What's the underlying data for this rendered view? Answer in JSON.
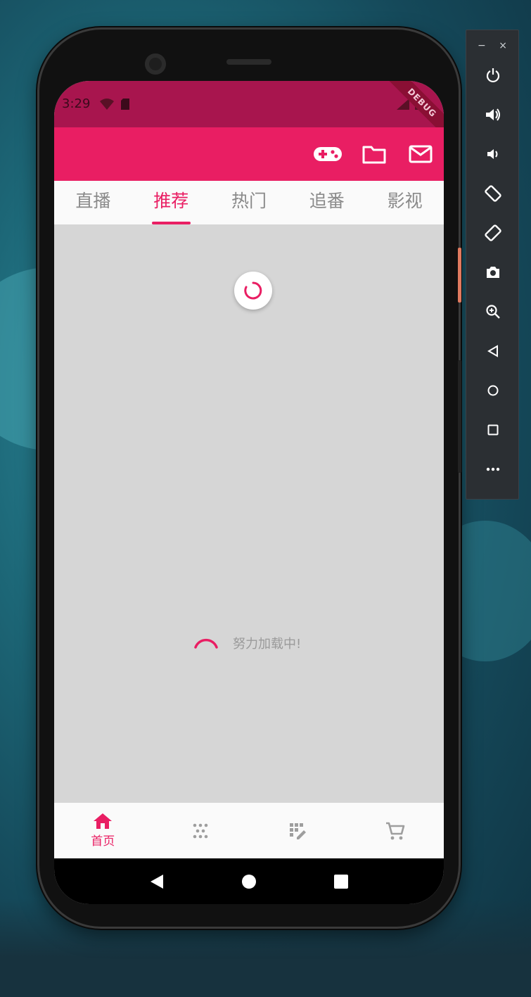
{
  "status_bar": {
    "time": "3:29",
    "debug_label": "DEBUG"
  },
  "tabs": [
    {
      "label": "直播",
      "active": false
    },
    {
      "label": "推荐",
      "active": true
    },
    {
      "label": "热门",
      "active": false
    },
    {
      "label": "追番",
      "active": false
    },
    {
      "label": "影视",
      "active": false
    }
  ],
  "loading": {
    "text": "努力加载中!"
  },
  "bottom_nav": [
    {
      "label": "首页",
      "icon": "home-icon",
      "active": true
    },
    {
      "label": "",
      "icon": "dots-grid-icon",
      "active": false
    },
    {
      "label": "",
      "icon": "edit-grid-icon",
      "active": false
    },
    {
      "label": "",
      "icon": "cart-icon",
      "active": false
    }
  ],
  "appbar_actions": [
    "gamepad-icon",
    "folder-icon",
    "mail-icon"
  ],
  "colors": {
    "accent": "#e91e63",
    "statusbar": "#a8154e",
    "content_bg": "#d6d6d6"
  },
  "emulator": {
    "window_controls": [
      "−",
      "×"
    ],
    "buttons": [
      "power-icon",
      "volume-up-icon",
      "volume-down-icon",
      "rotate-left-icon",
      "rotate-right-icon",
      "camera-icon",
      "zoom-icon",
      "back-icon",
      "home-circle-icon",
      "overview-icon",
      "more-icon"
    ]
  }
}
